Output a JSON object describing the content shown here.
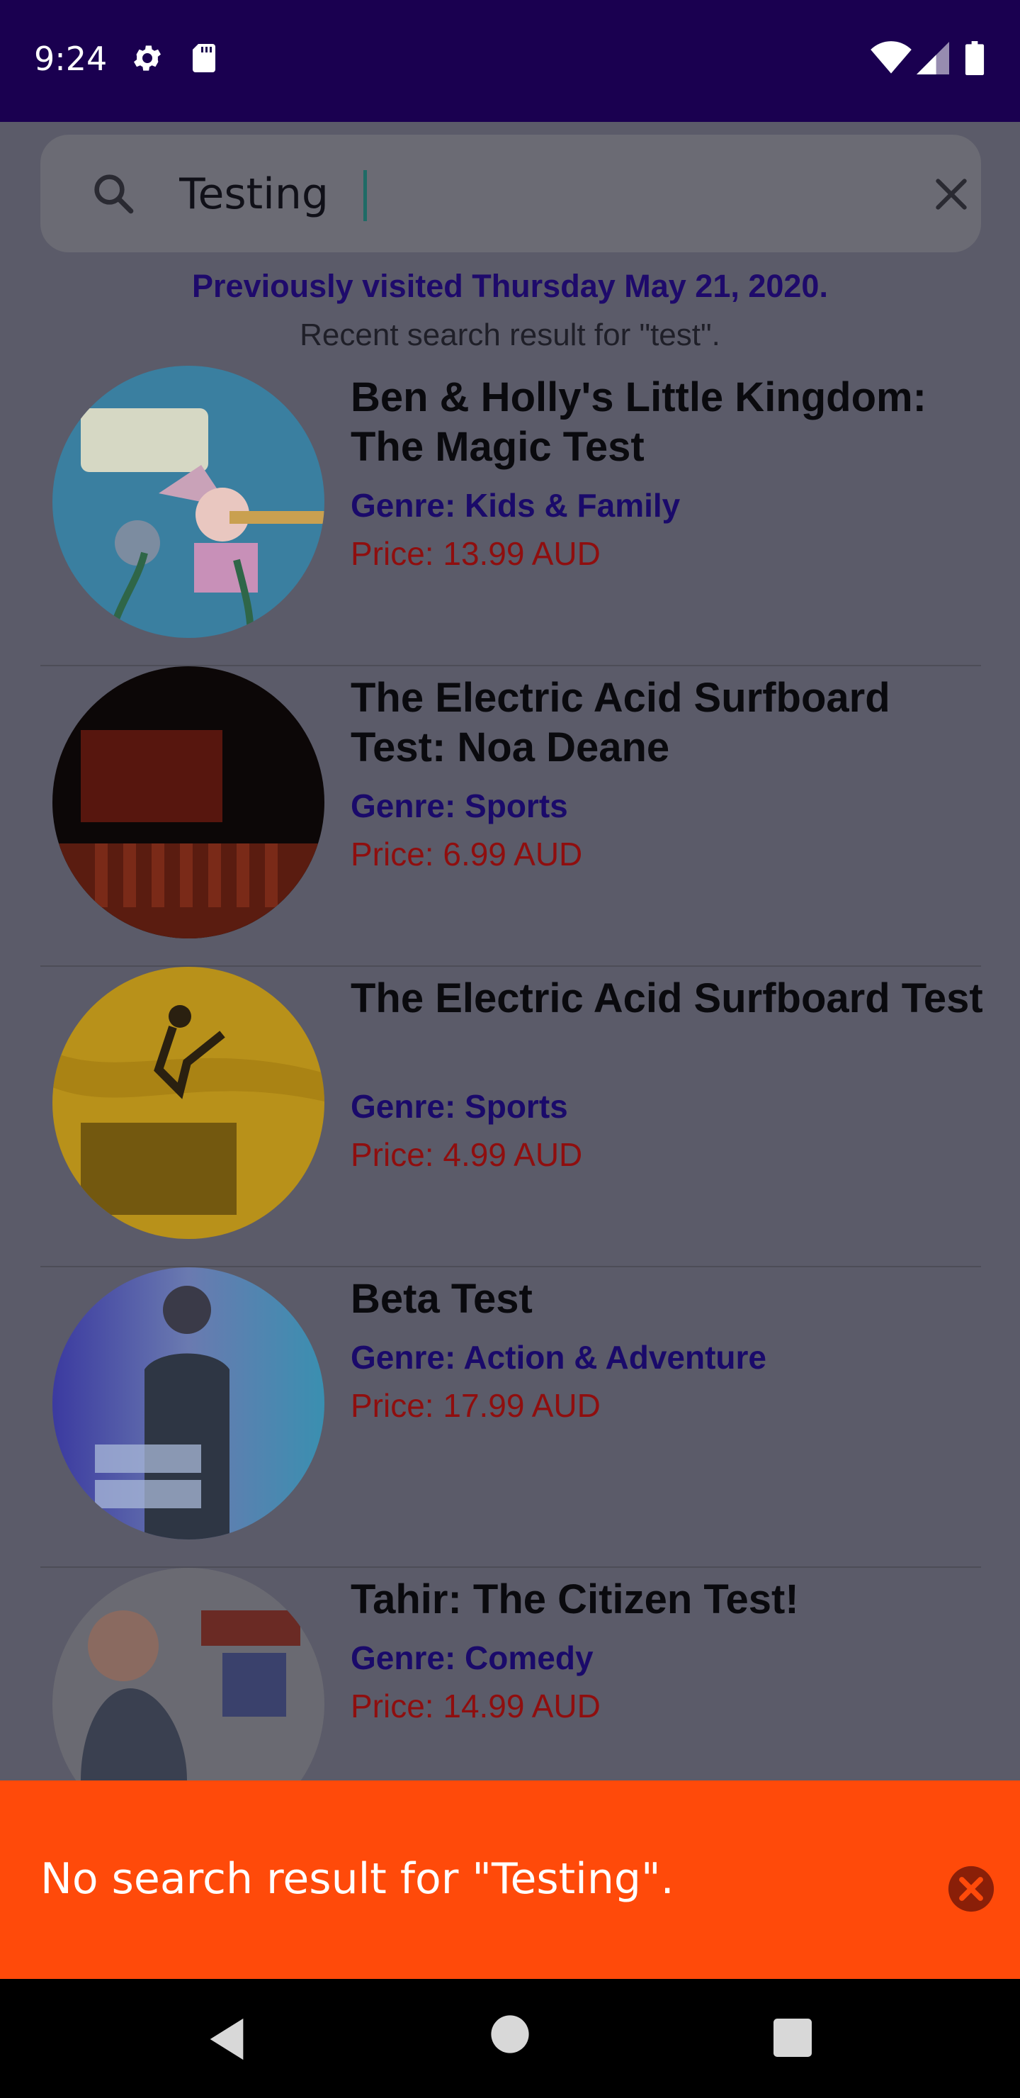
{
  "status_bar": {
    "time": "9:24"
  },
  "search": {
    "value": "Testing"
  },
  "history": {
    "visited": "Previously visited Thursday May 21, 2020.",
    "recent": "Recent search result for \"test\"."
  },
  "results": [
    {
      "title": "Ben & Holly's Little Kingdom: The Magic Test",
      "genre": "Genre: Kids & Family",
      "price": "Price: 13.99 AUD"
    },
    {
      "title": "The Electric Acid Surfboard Test: Noa Deane",
      "genre": "Genre: Sports",
      "price": "Price: 6.99 AUD"
    },
    {
      "title": "The Electric Acid Surfboard Test",
      "genre": "Genre: Sports",
      "price": "Price: 4.99 AUD"
    },
    {
      "title": "Beta Test",
      "genre": "Genre: Action & Adventure",
      "price": "Price: 17.99 AUD"
    },
    {
      "title": "Tahir: The Citizen Test!",
      "genre": "Genre: Comedy",
      "price": "Price: 14.99 AUD"
    }
  ],
  "snackbar": {
    "message": "No search result for \"Testing\"."
  },
  "colors": {
    "status_bar": "#1a0050",
    "snackbar": "#ff4a0a",
    "genre": "#1a0a6a",
    "price": "#8f0e0e"
  }
}
